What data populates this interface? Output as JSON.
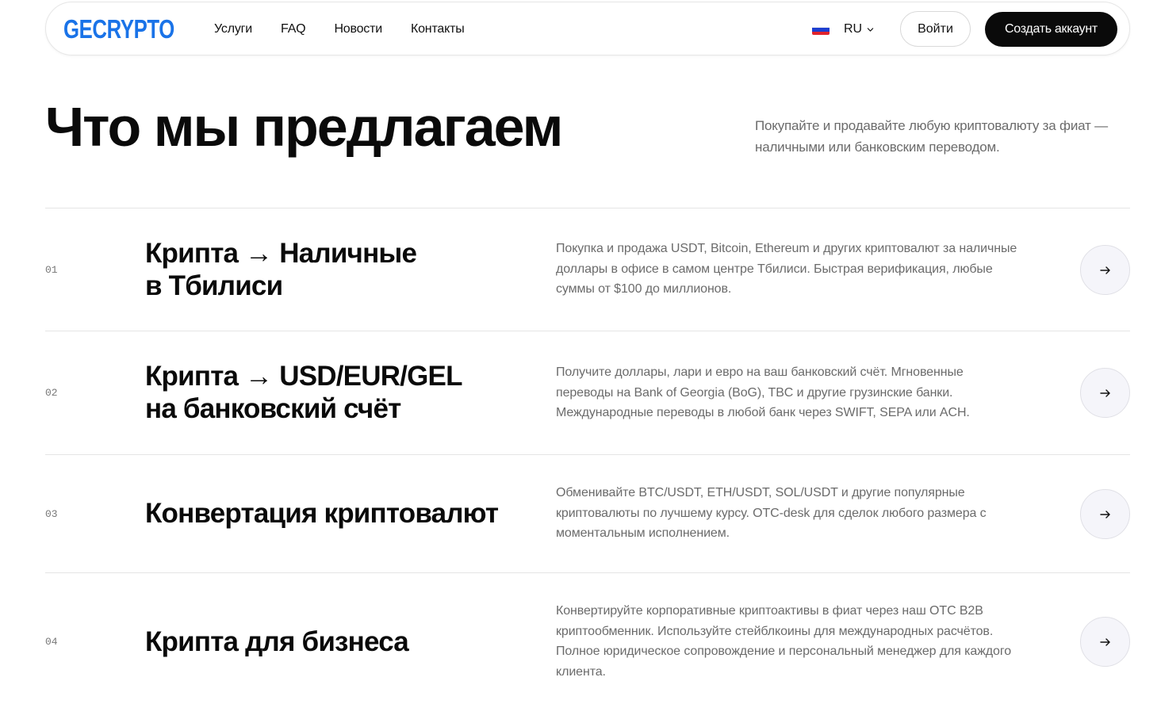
{
  "header": {
    "logo": "GECRYPTO",
    "nav": [
      "Услуги",
      "FAQ",
      "Новости",
      "Контакты"
    ],
    "language": "RU",
    "login_label": "Войти",
    "create_account_label": "Создать аккаунт",
    "colors": {
      "logo": "#1a73e8",
      "primary_button": "#0a0a0a"
    }
  },
  "hero": {
    "title": "Что мы предлагаем",
    "subtitle": "Покупайте и продавайте любую криптовалюту за фиат — наличными или банковским переводом."
  },
  "services": [
    {
      "number": "01",
      "title_line1": "Крипта → Наличные",
      "title_line2": "в Тбилиси",
      "description": "Покупка и продажа USDT, Bitcoin, Ethereum и других криптовалют за наличные доллары в офисе в самом центре Тбилиси. Быстрая верификация, любые суммы от $100 до миллионов."
    },
    {
      "number": "02",
      "title_line1": "Крипта → USD/EUR/GEL",
      "title_line2": "на банковский счёт",
      "description": "Получите доллары, лари и евро на ваш банковский счёт. Мгновенные переводы на Bank of Georgia (BoG), TBC и другие грузинские банки. Международные переводы в любой банк через SWIFT, SEPA или ACH."
    },
    {
      "number": "03",
      "title_line1": "Конвертация криптовалют",
      "title_line2": "",
      "description": "Обменивайте BTC/USDT, ETH/USDT, SOL/USDT и другие популярные криптовалюты по лучшему курсу. OTC-desk для сделок любого размера с моментальным исполнением."
    },
    {
      "number": "04",
      "title_line1": "Крипта для бизнеса",
      "title_line2": "",
      "description": "Конвертируйте корпоративные криптоактивы в фиат через наш OTC B2B криптообменник. Используйте стейблкоины для международных расчётов. Полное юридическое сопровождение и персональный менеджер для каждого клиента."
    }
  ]
}
